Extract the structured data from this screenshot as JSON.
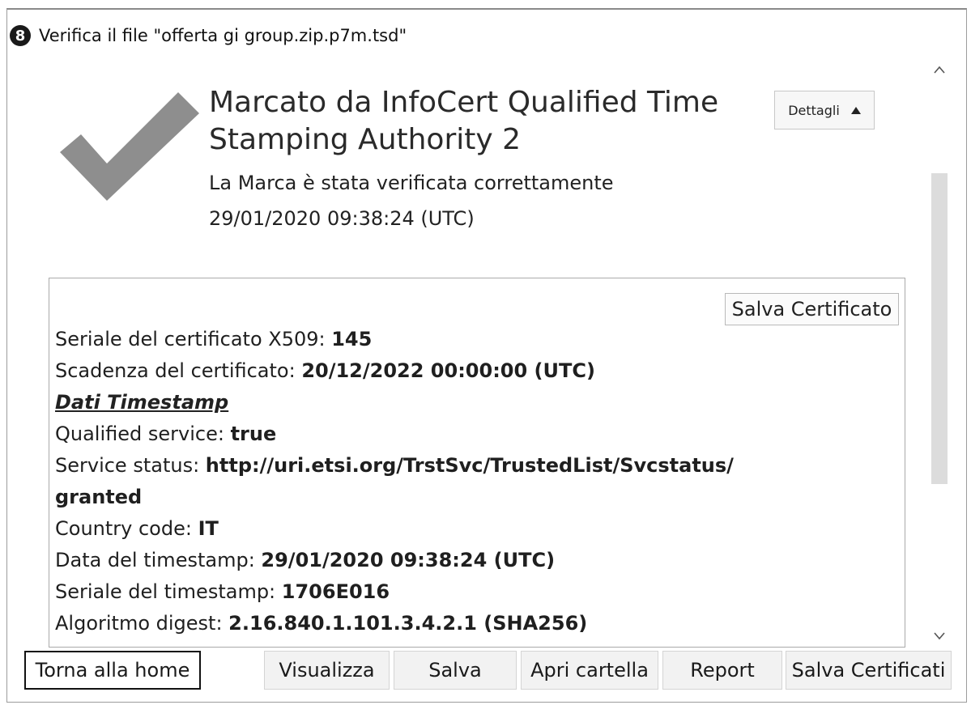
{
  "window": {
    "title": "Verifica il file \"offerta gi group.zip.p7m.tsd\"",
    "app_icon": "8"
  },
  "header": {
    "heading": "Marcato da InfoCert Qualified Time Stamping Authority 2",
    "subtitle": "La Marca è stata verificata correttamente",
    "timestamp": "29/01/2020 09:38:24 (UTC)",
    "details_button": "Dettagli",
    "status_icon": "check-icon",
    "check_color": "#8e8e8e"
  },
  "panel": {
    "save_certificate_button": "Salva Certificato",
    "rows": [
      {
        "label": "Seriale del certificato X509: ",
        "value": "145"
      },
      {
        "label": "Scadenza del certificato: ",
        "value": "20/12/2022 00:00:00 (UTC)"
      },
      {
        "section": "Dati Timestamp"
      },
      {
        "label": "Qualified service: ",
        "value": "true"
      },
      {
        "label": "Service status: ",
        "value": "http://uri.etsi.org/TrstSvc/TrustedList/Svcstatus/"
      },
      {
        "label": "",
        "value": "granted"
      },
      {
        "label": "Country code: ",
        "value": "IT"
      },
      {
        "label": "Data del timestamp: ",
        "value": "29/01/2020 09:38:24 (UTC)"
      },
      {
        "label": "Seriale del timestamp: ",
        "value": "1706E016"
      },
      {
        "label": "Algoritmo digest: ",
        "value": "2.16.840.1.101.3.4.2.1 (SHA256)"
      }
    ]
  },
  "footer": {
    "home": "Torna alla home",
    "view": "Visualizza",
    "save": "Salva",
    "open_folder": "Apri cartella",
    "report": "Report",
    "save_certificates": "Salva Certificati"
  }
}
